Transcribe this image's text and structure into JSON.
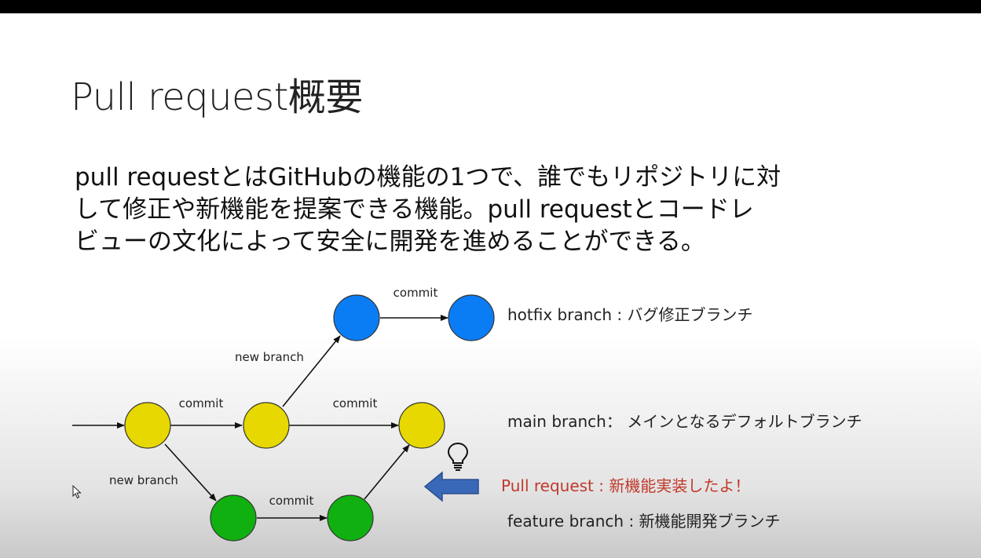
{
  "slide": {
    "title": "Pull request概要",
    "body_lines": [
      "pull requestとはGitHubの機能の1つで、誰でもリポジトリに対",
      "して修正や新機能を提案できる機能。pull requestとコードレ",
      "ビューの文化によって安全に開発を進めることができる。"
    ]
  },
  "diagram": {
    "edge_labels": {
      "hotfix_commit": "commit",
      "hotfix_new_branch": "new branch",
      "main_commit_1": "commit",
      "main_commit_2": "commit",
      "feature_new_branch": "new branch",
      "feature_commit": "commit"
    },
    "branch_descriptions": {
      "hotfix": "hotfix branch : バグ修正ブランチ",
      "main": "main branch： メインとなるデフォルトブランチ",
      "pull_request": "Pull request : 新機能実装したよ！",
      "feature": "feature branch : 新機能開発ブランチ"
    },
    "colors": {
      "hotfix_node": "#0a7df5",
      "main_node": "#e6d800",
      "feature_node": "#10b010",
      "pull_request_text": "#c0392b",
      "arrow_fill": "#3a68b8"
    },
    "icons": [
      "lightbulb-icon",
      "left-arrow-icon",
      "mouse-cursor-icon"
    ]
  }
}
